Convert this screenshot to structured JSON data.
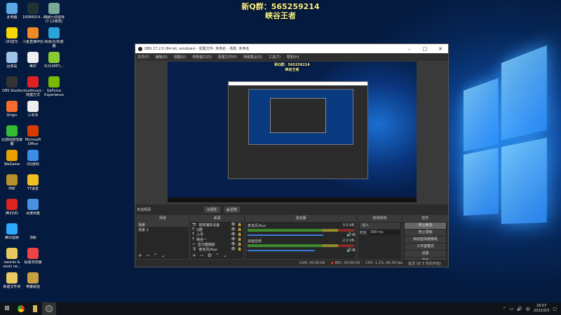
{
  "overlay": {
    "qq_group": "新Q群：565259214",
    "name": "峡谷王者"
  },
  "desktop_icons": [
    {
      "label": "此电脑",
      "color": "#5aa9e6"
    },
    {
      "label": "16086014...",
      "color": "#233"
    },
    {
      "label": "韩服行动选择(7.12修改)",
      "color": "#7a9"
    },
    {
      "label": "QQ音乐",
      "color": "#f5d800"
    },
    {
      "label": "斗鱼直播伴侣",
      "color": "#f08a24"
    },
    {
      "label": "网易UU加速器",
      "color": "#2aa4d8"
    },
    {
      "label": "回收站",
      "color": "#9cc3e8"
    },
    {
      "label": "维护",
      "color": "#eee"
    },
    {
      "label": "0(X(XMT)...",
      "color": "#8c3"
    },
    {
      "label": "OBS Studio",
      "color": "#333"
    },
    {
      "label": "cloudmusic - 快捷方式",
      "color": "#d22"
    },
    {
      "label": "GeForce Experience",
      "color": "#76b900"
    },
    {
      "label": "Origin",
      "color": "#f56c2d"
    },
    {
      "label": "小本本",
      "color": "#eee"
    },
    {
      "label": "",
      "color": "transparent"
    },
    {
      "label": "迅游网游加速器",
      "color": "#3b3"
    },
    {
      "label": "Microsoft Office",
      "color": "#d83b01"
    },
    {
      "label": "",
      "color": "transparent"
    },
    {
      "label": "WeGame",
      "color": "#e8a000"
    },
    {
      "label": "QQ游戏",
      "color": "#3a8ee6"
    },
    {
      "label": "",
      "color": "transparent"
    },
    {
      "label": "PBE",
      "color": "#b8902a"
    },
    {
      "label": "YY语音",
      "color": "#f0c020"
    },
    {
      "label": "",
      "color": "transparent"
    },
    {
      "label": "腾讯QQ",
      "color": "#d22"
    },
    {
      "label": "百度网盘",
      "color": "#4a90e2"
    },
    {
      "label": "",
      "color": "transparent"
    },
    {
      "label": "腾讯视频",
      "color": "#2fa8ff"
    },
    {
      "label": "顶新",
      "color": "transparent"
    },
    {
      "label": "",
      "color": "transparent"
    },
    {
      "label": "swords & souls ne...",
      "color": "#e8c860"
    },
    {
      "label": "极速浏览器",
      "color": "#e44"
    },
    {
      "label": "",
      "color": "transparent"
    },
    {
      "label": "新建文件夹",
      "color": "#e8c860"
    },
    {
      "label": "英雄联盟",
      "color": "#c8a040"
    },
    {
      "label": "",
      "color": "transparent"
    }
  ],
  "obs": {
    "title": "OBS 27.2.0 (64-bit, windows) - 配置文件: 未命名 - 场景: 未命名",
    "menu": [
      "文件(F)",
      "编辑(E)",
      "视图(V)",
      "停靠窗口(D)",
      "配置文件(P)",
      "场景集合(S)",
      "工具(T)",
      "帮助(H)"
    ],
    "no_source": "未选择源",
    "props": "⚙属性",
    "filters": "◐滤镜",
    "scenes": {
      "title": "场景",
      "items": [
        "场景",
        "场景 2"
      ]
    },
    "sources": {
      "title": "来源",
      "items": [
        {
          "icon": "📷",
          "label": "视频捕获设备"
        },
        {
          "icon": "T",
          "label": "Q群"
        },
        {
          "icon": "T",
          "label": "小号"
        },
        {
          "icon": "T",
          "label": "峡谷一"
        },
        {
          "icon": "▭",
          "label": "显示器捕获"
        },
        {
          "icon": "🎙",
          "label": "麦克风/Aux"
        }
      ]
    },
    "mixer": {
      "title": "混音器",
      "channels": [
        {
          "name": "麦克风/Aux",
          "db": "0.0 dB",
          "volume": 0.9
        },
        {
          "name": "桌面音频",
          "db": "-2.0 dB",
          "volume": 0.8
        }
      ]
    },
    "transitions": {
      "title": "转场特效",
      "selected": "淡入",
      "duration_label": "时长",
      "duration": "300 ms"
    },
    "controls": {
      "title": "控件",
      "buttons": [
        "停止推流",
        "停止录制",
        "启动虚拟摄像机",
        "工作室模式",
        "设置",
        "退出"
      ]
    },
    "status": {
      "live": "LIVE: 00:00:00",
      "rec": "REC: 00:00:00",
      "cpu": "CPU: 1.1%, 60.00 fps",
      "delay": "延迟 (在 5 秒后开始)"
    }
  },
  "taskbar": {
    "time": "18:07",
    "date": "2022/3/3"
  }
}
